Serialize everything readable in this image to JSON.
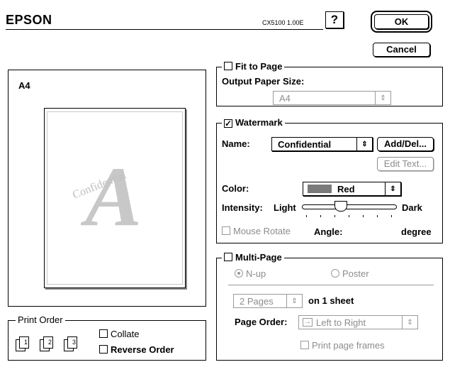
{
  "header": {
    "brand": "EPSON",
    "model": "CX5100 1.00E",
    "help_label": "?",
    "ok_label": "OK",
    "cancel_label": "Cancel"
  },
  "preview": {
    "paper_size": "A4",
    "watermark_letter": "A",
    "watermark_text": "Confidential"
  },
  "fit_to_page": {
    "label": "Fit to Page",
    "checked": false,
    "output_paper_size_label": "Output Paper Size:",
    "output_paper_size_value": "A4"
  },
  "watermark": {
    "label": "Watermark",
    "checked": true,
    "check_glyph": "✓",
    "name_label": "Name:",
    "name_value": "Confidential",
    "add_del_label": "Add/Del...",
    "edit_text_label": "Edit Text...",
    "color_label": "Color:",
    "color_value": "Red",
    "color_swatch": "#7a7a7a",
    "intensity_label": "Intensity:",
    "intensity_light": "Light",
    "intensity_dark": "Dark",
    "intensity_level": 0.4,
    "mouse_rotate_label": "Mouse Rotate",
    "angle_label": "Angle:",
    "degree_label": "degree"
  },
  "multi_page": {
    "label": "Multi-Page",
    "checked": false,
    "nup_label": "N-up",
    "poster_label": "Poster",
    "pages_value": "2 Pages",
    "on_sheet_label": "on 1 sheet",
    "page_order_label": "Page Order:",
    "page_order_value": "Left to Right",
    "page_order_glyph": "→",
    "print_frames_label": "Print page frames"
  },
  "print_order": {
    "label": "Print Order",
    "collate_label": "Collate",
    "reverse_label": "Reverse Order",
    "icon_numbers": [
      "1",
      "2",
      "3"
    ]
  },
  "glyphs": {
    "updown": "⇕"
  }
}
